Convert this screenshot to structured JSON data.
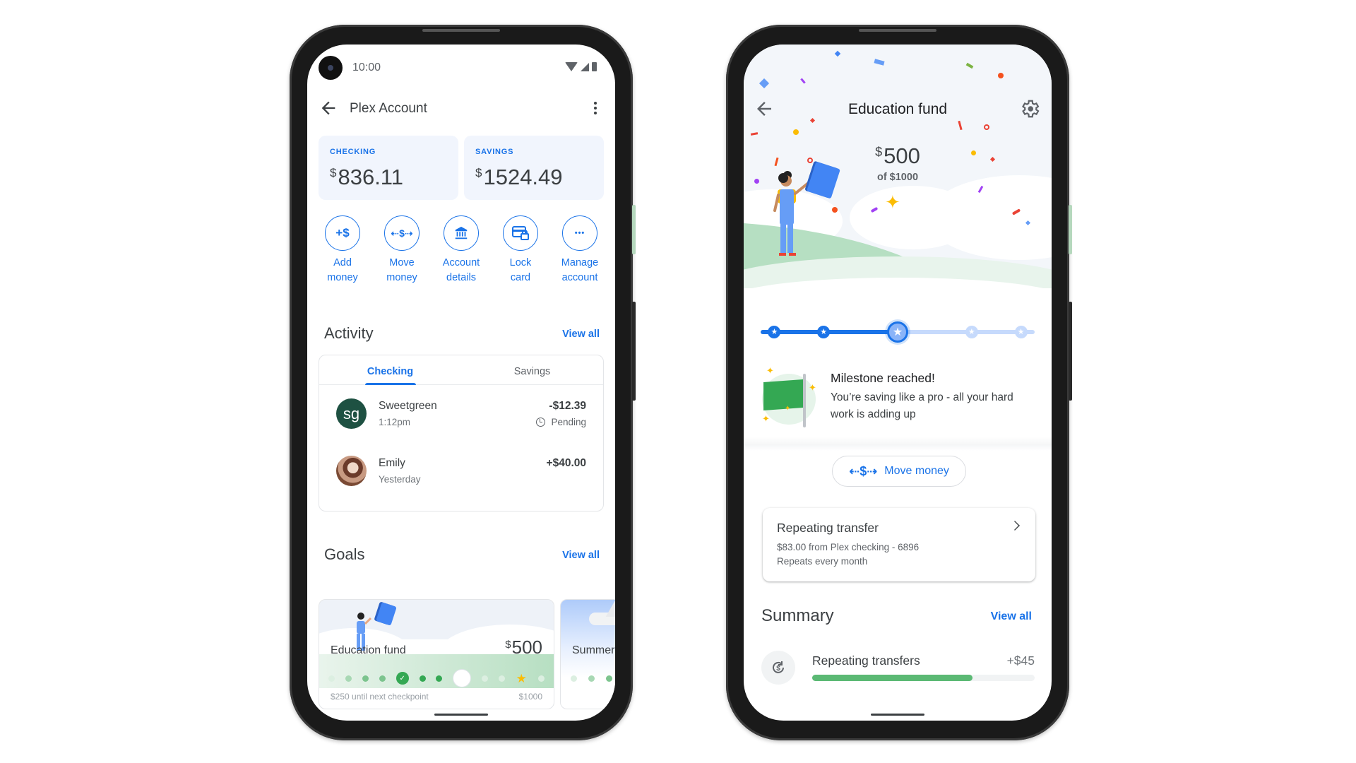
{
  "status_bar": {
    "time": "10:00"
  },
  "left_phone": {
    "app_bar": {
      "title": "Plex Account"
    },
    "balances": [
      {
        "label": "CHECKING",
        "currency": "$",
        "amount": "836.11"
      },
      {
        "label": "SAVINGS",
        "currency": "$",
        "amount": "1524.49"
      }
    ],
    "actions": [
      {
        "icon": "add-money-icon",
        "glyph": "+$",
        "label": "Add\nmoney"
      },
      {
        "icon": "move-money-icon",
        "glyph": "⇠$⇢",
        "label": "Move\nmoney"
      },
      {
        "icon": "bank-icon",
        "glyph": "🏛",
        "label": "Account\ndetails"
      },
      {
        "icon": "lock-card-icon",
        "glyph": "💳",
        "label": "Lock\ncard"
      },
      {
        "icon": "more-horiz-icon",
        "glyph": "•••",
        "label": "Manage\naccount"
      }
    ],
    "activity": {
      "title": "Activity",
      "view_all": "View all",
      "tabs": [
        {
          "label": "Checking",
          "active": true
        },
        {
          "label": "Savings",
          "active": false
        }
      ],
      "transactions": [
        {
          "avatar_text": "sg",
          "name": "Sweetgreen",
          "time": "1:12pm",
          "amount": "-$12.39",
          "status": "Pending"
        },
        {
          "avatar_text": "",
          "name": "Emily",
          "time": "Yesterday",
          "amount": "+$40.00",
          "status": ""
        }
      ]
    },
    "goals": {
      "title": "Goals",
      "view_all": "View all",
      "cards": [
        {
          "name": "Education fund",
          "currency": "$",
          "amount": "500",
          "footer_left": "$250 until next checkpoint",
          "footer_right": "$1000"
        },
        {
          "name": "Summer"
        }
      ]
    }
  },
  "right_phone": {
    "app_bar": {
      "title": "Education fund"
    },
    "hero": {
      "currency": "$",
      "amount": "500",
      "of_label": "of $1000"
    },
    "milestones": {
      "total": 5,
      "reached": 3,
      "progress_fraction": 0.5
    },
    "milestone_message": {
      "title": "Milestone reached!",
      "text": "You’re saving like a pro - all your hard work is adding up"
    },
    "move_money_button": {
      "glyph": "⇠$⇢",
      "label": "Move money"
    },
    "repeating_transfer": {
      "title": "Repeating transfer",
      "line1": "$83.00 from Plex checking - 6896",
      "line2": "Repeats every month"
    },
    "summary": {
      "title": "Summary",
      "view_all": "View all",
      "rows": [
        {
          "label": "Repeating transfers",
          "value": "+$45",
          "progress_fraction": 0.72
        }
      ]
    }
  },
  "colors": {
    "accent": "#1a73e8",
    "success": "#34a853",
    "star": "#fbbc04",
    "sweetgreen": "#1e5142"
  }
}
